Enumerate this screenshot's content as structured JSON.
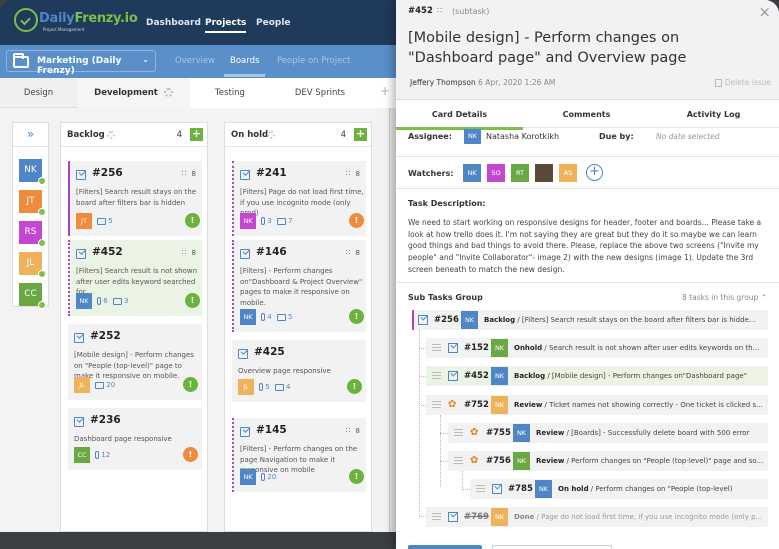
{
  "colors": {
    "blue": "#4f86c6",
    "green": "#7cbf4a",
    "orange": "#ef8b3c",
    "magenta": "#c447d0",
    "yellow": "#eeb25a",
    "olive": "#6aa843",
    "navy": "#1f3a5a"
  },
  "app": {
    "brand_a": "Daily",
    "brand_b": "Frenzy",
    "brand_c": ".io",
    "tagline": "Project Management"
  },
  "topnav": {
    "items": [
      "Dashboard",
      "Projects",
      "People"
    ],
    "active": "Projects"
  },
  "project": {
    "name": "Marketing (Daily Frenzy)",
    "subnav": [
      "Overview",
      "Boards",
      "People on Project"
    ],
    "active": "Boards"
  },
  "boards": {
    "tabs": [
      "Design",
      "Development",
      "Testing",
      "DEV Sprints"
    ],
    "active": "Development",
    "add": "+"
  },
  "people": [
    {
      "initials": "NK",
      "color": "#4f86c6"
    },
    {
      "initials": "JT",
      "color": "#ef8b3c"
    },
    {
      "initials": "RS",
      "color": "#c447d0"
    },
    {
      "initials": "JL",
      "color": "#eeb25a"
    },
    {
      "initials": "CC",
      "color": "#6aa843"
    }
  ],
  "columns": [
    {
      "name": "Backlog",
      "count": "4",
      "cards": [
        {
          "id": "#256",
          "desc": "[Filters]  Search result stays on the board after filters bar is hidden",
          "subtasks": "8",
          "assignee": "JT",
          "assignee_color": "#ef8b3c",
          "attachments": "",
          "comments": "5",
          "priority": "!",
          "priority_color": "#6cb33e"
        },
        {
          "id": "#452",
          "desc": "[Filters] Search result is not shown after user edits keyword searched for",
          "subtasks": "8",
          "assignee": "NK",
          "assignee_color": "#4f86c6",
          "attachments": "6",
          "comments": "3",
          "priority": "!",
          "priority_color": "#6cb33e"
        },
        {
          "id": "#252",
          "desc": "[Mobile design] - Perform changes on \"People (top-level)\" page to make it responsive on mobile.",
          "subtasks": "",
          "assignee": "JL",
          "assignee_color": "#eeb25a",
          "attachments": "",
          "comments": "20",
          "priority": "!",
          "priority_color": "#6cb33e"
        },
        {
          "id": "#236",
          "desc": "Dashboard page responsive",
          "subtasks": "",
          "assignee": "CC",
          "assignee_color": "#6aa843",
          "attachments": "12",
          "comments": "",
          "priority": "!",
          "priority_color": "#ef8b3c"
        }
      ]
    },
    {
      "name": "On hold",
      "count": "4",
      "cards": [
        {
          "id": "#241",
          "desc": "[Filters] Page do not load first time, if you use incognito mode (only prod)",
          "subtasks": "8",
          "assignee": "NK",
          "assignee_color": "#c447d0",
          "attachments": "3",
          "comments": "7",
          "priority": "!",
          "priority_color": "#ef8b3c"
        },
        {
          "id": "#146",
          "desc": "[Filters] - Perform changes on\"Dashboard & Project Overview\" pages to make it responsive on mobile.",
          "subtasks": "8",
          "assignee": "NK",
          "assignee_color": "#4f86c6",
          "attachments": "4",
          "comments": "5",
          "priority": "!",
          "priority_color": "#6cb33e"
        },
        {
          "id": "#425",
          "desc": "Overview page responsive",
          "subtasks": "",
          "assignee": "JL",
          "assignee_color": "#eeb25a",
          "attachments": "5",
          "comments": "4",
          "priority": "!",
          "priority_color": "#6cb33e"
        },
        {
          "id": "#145",
          "desc": "[Filters]  - Perform changes on the page Navigation to make it responsive on mobile",
          "subtasks": "8",
          "assignee": "NK",
          "assignee_color": "#4f86c6",
          "attachments": "20",
          "comments": "",
          "priority": "!",
          "priority_color": "#6cb33e"
        }
      ]
    }
  ],
  "detail": {
    "id": "#452",
    "type": "(subtask)",
    "close": "×",
    "title": "[Mobile design] - Perform changes on \"Dashboard page\" and Overview page",
    "author": "Jeffery Thompson",
    "date": "6 Apr, 2020 1:26 AM",
    "delete": "Delete issue",
    "tabs": [
      "Card Details",
      "Comments",
      "Activity Log"
    ],
    "active_tab": "Card Details",
    "assignee_label": "Assignee:",
    "assignee_initials": "NK",
    "assignee_name": "Natasha Korotkikh",
    "due_label": "Due by:",
    "due_value": "No date selected",
    "watchers_label": "Watchers:",
    "watchers": [
      {
        "initials": "NK",
        "color": "#4f86c6"
      },
      {
        "initials": "SO",
        "color": "#c447d0"
      },
      {
        "initials": "RT",
        "color": "#6aa843"
      },
      {
        "initials": "",
        "color": "#5a4a3a"
      },
      {
        "initials": "AS",
        "color": "#eeb25a"
      }
    ],
    "desc_label": "Task Description:",
    "description": "We need to start working on responsive designs for header, footer and boards... Please take a look at how trello does it. I'm not saying they are great but they do it so maybe we can learn good things and bad things to avoid there. Please, replace the above two screens (\"Invite my people\" and \"Invite Collaborator\"- image 2) with the new designs (image 1). Update the 3rd screen beneath to match the new design.",
    "subtasks_label": "Sub Tasks Group",
    "subtasks_count": "8 tasks in this group",
    "subtasks": [
      {
        "id": "#256",
        "kind": "task",
        "initials": "NK",
        "color": "#4f86c6",
        "status": "Backlog",
        "text": " / [Filters]  Search result stays on the board after filters bar is hidde...",
        "strike": false
      },
      {
        "id": "#152",
        "kind": "task",
        "initials": "NK",
        "color": "#6aa843",
        "status": "Onhold",
        "text": " / Search result is not shown after user edits keywords on th...",
        "strike": false
      },
      {
        "id": "#452",
        "kind": "task",
        "initials": "NK",
        "color": "#4f86c6",
        "status": "Backlog",
        "text": " / [Mobile design] - Perform changes on\"Dashboard page\"",
        "strike": false
      },
      {
        "id": "#752",
        "kind": "bug",
        "initials": "NK",
        "color": "#eeb25a",
        "status": "Review",
        "text": " / Ticket names not showing correctly - One ticket is clicked s...",
        "strike": false
      },
      {
        "id": "#755",
        "kind": "bug",
        "initials": "NK",
        "color": "#4f86c6",
        "status": "Review",
        "text": " / [Boards] - Successfully delete board with 500 error",
        "strike": false
      },
      {
        "id": "#756",
        "kind": "bug",
        "initials": "NK",
        "color": "#6aa843",
        "status": "Review",
        "text": " / Perform changes on \"People (top-level)\" page and so...",
        "strike": false
      },
      {
        "id": "#785",
        "kind": "task",
        "initials": "NK",
        "color": "#4f86c6",
        "status": "On hold",
        "text": " / Perform changes on \"People (top-level)",
        "strike": false
      },
      {
        "id": "#769",
        "kind": "task",
        "initials": "NK",
        "color": "#eeb25a",
        "status": "Done",
        "text": " / Page do not load first time, if you use incognito mode (only p...",
        "strike": true
      }
    ]
  }
}
